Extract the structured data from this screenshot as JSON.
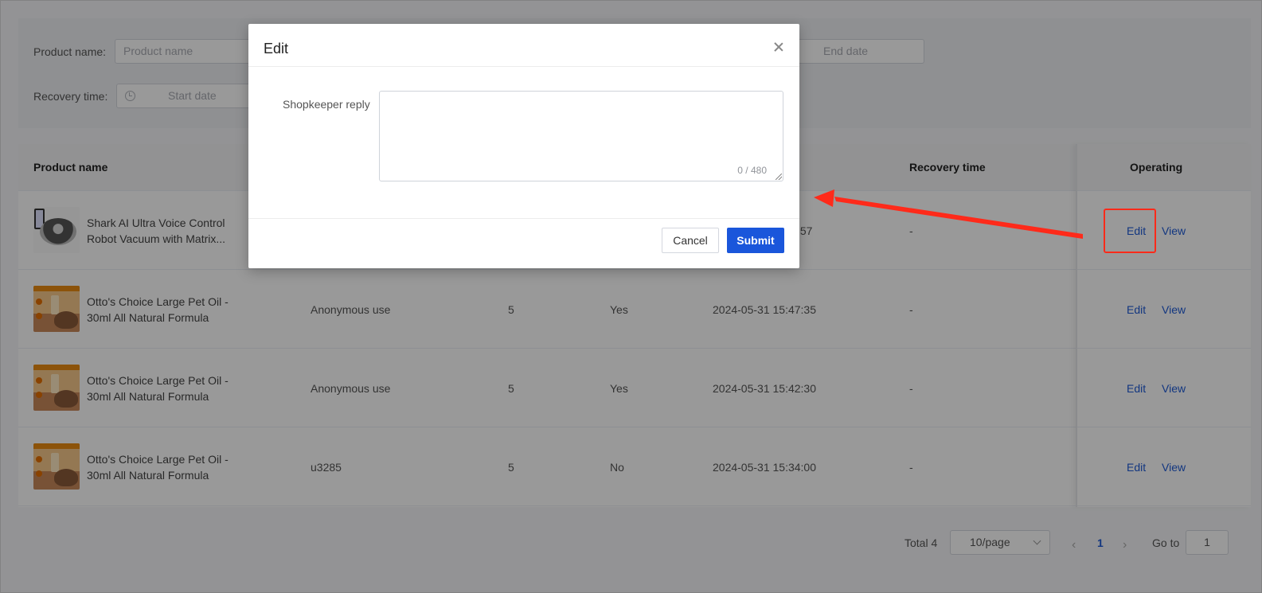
{
  "filters": {
    "product_name_label": "Product name:",
    "product_name_placeholder": "Product name",
    "end_date_placeholder": "End date",
    "recovery_time_label": "Recovery time:",
    "start_date_placeholder": "Start date"
  },
  "table": {
    "headers": {
      "product_name": "Product name",
      "recovery_time": "Recovery time",
      "operating": "Operating"
    },
    "rows": [
      {
        "product": "Shark AI Ultra Voice Control Robot Vacuum with Matrix...",
        "user": "",
        "score": "",
        "flag": "",
        "time": ":57",
        "recovery": "-",
        "thumb": "robot-vacuum"
      },
      {
        "product": "Otto's Choice Large Pet Oil - 30ml All Natural Formula",
        "user": "Anonymous use",
        "score": "5",
        "flag": "Yes",
        "time": "2024-05-31 15:47:35",
        "recovery": "-",
        "thumb": "pet-oil"
      },
      {
        "product": "Otto's Choice Large Pet Oil - 30ml All Natural Formula",
        "user": "Anonymous use",
        "score": "5",
        "flag": "Yes",
        "time": "2024-05-31 15:42:30",
        "recovery": "-",
        "thumb": "pet-oil"
      },
      {
        "product": "Otto's Choice Large Pet Oil - 30ml All Natural Formula",
        "user": "u3285",
        "score": "5",
        "flag": "No",
        "time": "2024-05-31 15:34:00",
        "recovery": "-",
        "thumb": "pet-oil"
      }
    ],
    "edit_label": "Edit",
    "view_label": "View"
  },
  "pagination": {
    "total": "Total 4",
    "page_size": "10/page",
    "prev_icon": "‹",
    "current_page": "1",
    "next_icon": "›",
    "goto_label": "Go to",
    "goto_value": "1"
  },
  "dialog": {
    "title": "Edit",
    "reply_label": "Shopkeeper reply",
    "reply_value": "",
    "char_count": "0 / 480",
    "cancel_label": "Cancel",
    "submit_label": "Submit"
  },
  "colors": {
    "primary": "#1a56db",
    "link": "#1f5bd6",
    "annotation": "#ff2a1a"
  }
}
